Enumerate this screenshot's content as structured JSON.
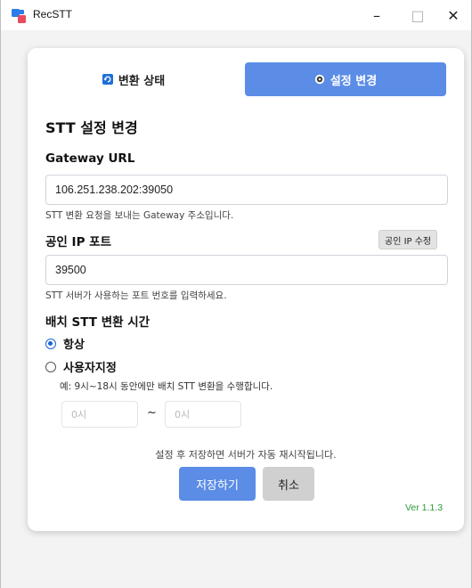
{
  "window": {
    "title": "RecSTT",
    "minimize_glyph": "–",
    "maximize_glyph": "□",
    "close_glyph": "✕"
  },
  "tabs": [
    {
      "label": "변환 상태",
      "icon": "refresh-icon",
      "active": false
    },
    {
      "label": "설정 변경",
      "icon": "gear-icon",
      "active": true
    }
  ],
  "settings": {
    "title": "STT 설정 변경",
    "gateway": {
      "label": "Gateway URL",
      "value": "106.251.238.202:39050",
      "help": "STT 변환 요청을 보내는 Gateway 주소입니다."
    },
    "port": {
      "label": "공인 IP 포트",
      "edit_button": "공인 IP 수정",
      "value": "39500",
      "help": "STT 서버가 사용하는 포트 번호를 입력하세요."
    },
    "batch": {
      "label": "배치 STT 변환 시간",
      "option_always": "항상",
      "option_custom": "사용자지정",
      "selected": "항상",
      "example": "예: 9시~18시 동안에만 배치 STT 변환을 수행합니다.",
      "start_placeholder": "0시",
      "end_placeholder": "0시",
      "separator": "~"
    },
    "notice": "설정 후 저장하면 서버가 자동 재시작됩니다.",
    "save_label": "저장하기",
    "cancel_label": "취소",
    "version": "Ver 1.1.3"
  },
  "colors": {
    "accent": "#5b8ce6",
    "radio": "#1a64d6",
    "version": "#2e9a3a"
  }
}
